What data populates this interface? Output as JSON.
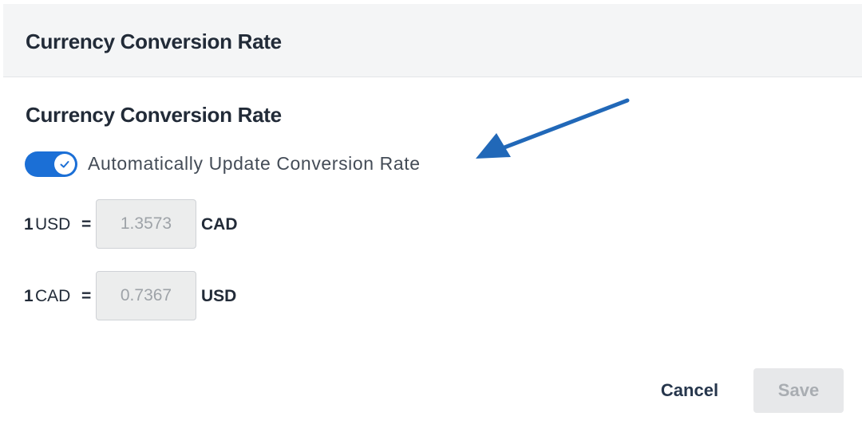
{
  "dialog": {
    "title": "Currency Conversion Rate"
  },
  "section": {
    "title": "Currency Conversion Rate"
  },
  "auto_update": {
    "label": "Automatically Update Conversion Rate",
    "enabled": true,
    "icon": "check-icon"
  },
  "rates": [
    {
      "amount": "1",
      "from": "USD",
      "equals": "=",
      "value": "1.3573",
      "to": "CAD"
    },
    {
      "amount": "1",
      "from": "CAD",
      "equals": "=",
      "value": "0.7367",
      "to": "USD"
    }
  ],
  "actions": {
    "cancel_label": "Cancel",
    "save_label": "Save"
  },
  "colors": {
    "accent": "#1b6fd6",
    "annotation_arrow": "#2168b8",
    "header_bg": "#f4f5f6"
  },
  "annotation": {
    "icon": "arrow-annotation-icon"
  }
}
